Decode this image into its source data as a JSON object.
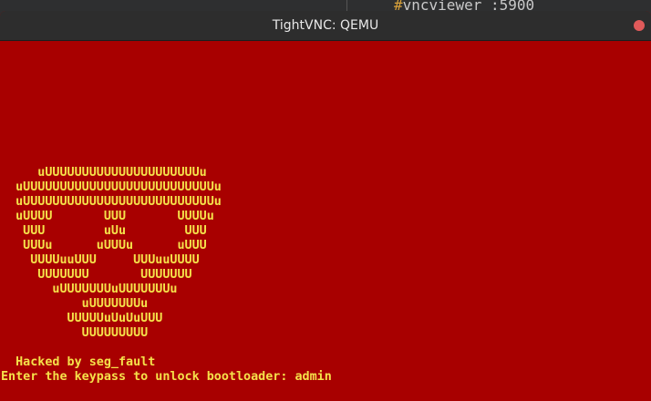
{
  "background_editor": {
    "code_hash": "#",
    "code_text": "vncviewer :5900"
  },
  "window": {
    "title": "TightVNC: QEMU"
  },
  "terminal": {
    "art_lines": [
      "     uUUUUUUUUUUUUUUUUUUUUUu",
      "  uUUUUUUUUUUUUUUUUUUUUUUUUUUu",
      "  uUUUUUUUUUUUUUUUUUUUUUUUUUUu",
      "  uUUUU       UUU       UUUUu",
      "   UUU        uUu        UUU",
      "   UUUu      uUUUu      uUUU",
      "    UUUUuuUUU     UUUuuUUUU",
      "     UUUUUUU       UUUUUUU",
      "       uUUUUUUUuUUUUUUUu",
      "           uUUUUUUUu",
      "         UUUUUuUuUuUUU",
      "           UUUUUUUUU"
    ],
    "blank_line": "",
    "hacked_line": "  Hacked by seg_fault",
    "prompt_line": "Enter the keypass to unlock bootloader: admin"
  },
  "colors": {
    "screen_bg": "#a80000",
    "text": "#f5e14a",
    "titlebar": "#2d2d2d"
  },
  "icons": {
    "close": "close-icon"
  }
}
